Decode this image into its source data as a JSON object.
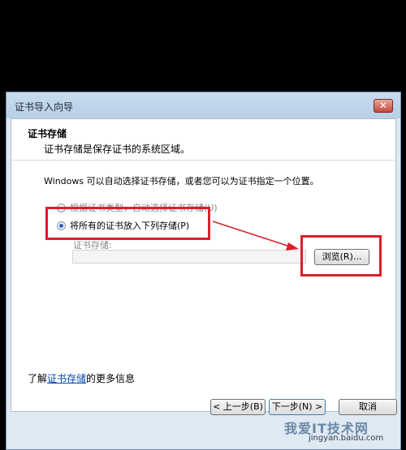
{
  "dialog": {
    "title": "证书导入向导",
    "close_glyph": "✕",
    "header": {
      "title": "证书存储",
      "description": "证书存储是保存证书的系统区域。"
    },
    "intro": "Windows 可以自动选择证书存储，或者您可以为证书指定一个位置。",
    "options": [
      {
        "label": "根据证书类型，自动选择证书存储(U)",
        "checked": false
      },
      {
        "label": "将所有的证书放入下列存储(P)",
        "checked": true
      }
    ],
    "store": {
      "label": "证书存储:",
      "value": "",
      "browse_label": "浏览(R)..."
    },
    "learn_more": {
      "prefix": "了解",
      "link": "证书存储",
      "suffix": "的更多信息"
    },
    "buttons": {
      "back": "< 上一步(B)",
      "next": "下一步(N) >",
      "cancel": "取消"
    }
  },
  "watermark": {
    "text": "我爱IT技术网",
    "domain": "jingyan.baidu.com"
  },
  "colors": {
    "annotation": "#d9202c",
    "accent": "#2a63b3"
  }
}
